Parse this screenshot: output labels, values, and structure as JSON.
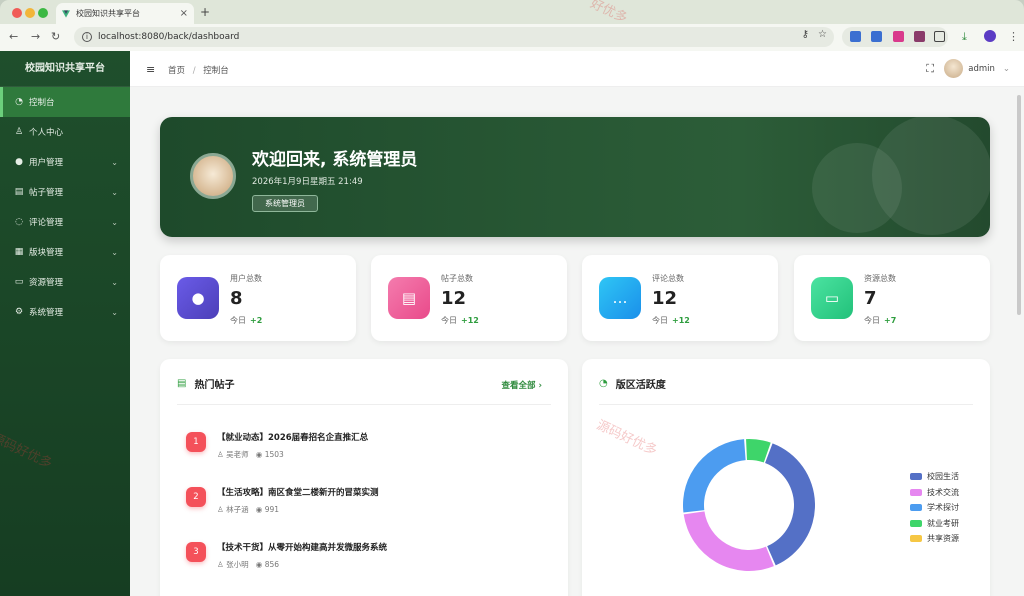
{
  "browser": {
    "tab_title": "校园知识共享平台",
    "url": "localhost:8080/back/dashboard"
  },
  "sidebar": {
    "brand": "校园知识共享平台",
    "items": [
      {
        "label": "控制台",
        "icon": "dashboard-icon",
        "active": true
      },
      {
        "label": "个人中心",
        "icon": "user-outline-icon"
      },
      {
        "label": "用户管理",
        "icon": "user-icon",
        "expandable": true
      },
      {
        "label": "帖子管理",
        "icon": "document-icon",
        "expandable": true
      },
      {
        "label": "评论管理",
        "icon": "chat-icon",
        "expandable": true
      },
      {
        "label": "版块管理",
        "icon": "grid-icon",
        "expandable": true
      },
      {
        "label": "资源管理",
        "icon": "folder-icon",
        "expandable": true
      },
      {
        "label": "系统管理",
        "icon": "gear-icon",
        "expandable": true
      }
    ]
  },
  "header": {
    "breadcrumb_home": "首页",
    "breadcrumb_sep": "/",
    "breadcrumb_current": "控制台",
    "username": "admin"
  },
  "hero": {
    "title": "欢迎回来, 系统管理员",
    "date": "2026年1月9日星期五 21:49",
    "role_badge": "系统管理员"
  },
  "stats": [
    {
      "label": "用户总数",
      "value": "8",
      "today_label": "今日",
      "today_delta": "+2",
      "color": "#5b4fd6"
    },
    {
      "label": "帖子总数",
      "value": "12",
      "today_label": "今日",
      "today_delta": "+12",
      "color": "#ee5a9b"
    },
    {
      "label": "评论总数",
      "value": "12",
      "today_label": "今日",
      "today_delta": "+12",
      "color": "#1bb6f0"
    },
    {
      "label": "资源总数",
      "value": "7",
      "today_label": "今日",
      "today_delta": "+7",
      "color": "#33d28b"
    }
  ],
  "hot_posts": {
    "title": "热门帖子",
    "view_all": "查看全部",
    "items": [
      {
        "rank": "1",
        "title": "【就业动态】2026届春招名企直推汇总",
        "author": "吴老师",
        "views": "1503"
      },
      {
        "rank": "2",
        "title": "【生活攻略】南区食堂二楼新开的冒菜实测",
        "author": "林子涵",
        "views": "991"
      },
      {
        "rank": "3",
        "title": "【技术干货】从零开始构建高并发微服务系统",
        "author": "张小明",
        "views": "856"
      }
    ]
  },
  "activity": {
    "title": "版区活跃度",
    "chart_data": {
      "type": "pie",
      "categories": [
        "校园生活",
        "技术交流",
        "学术探讨",
        "就业考研",
        "共享资源"
      ],
      "values": [
        35,
        27,
        24,
        6,
        0
      ],
      "colors": [
        "#5470c6",
        "#e687f0",
        "#4c9cf0",
        "#3ed56a",
        "#f6c744"
      ],
      "legend_position": "right"
    }
  },
  "watermarks": [
    "源码好优多",
    "好优多",
    "源码好优多"
  ]
}
